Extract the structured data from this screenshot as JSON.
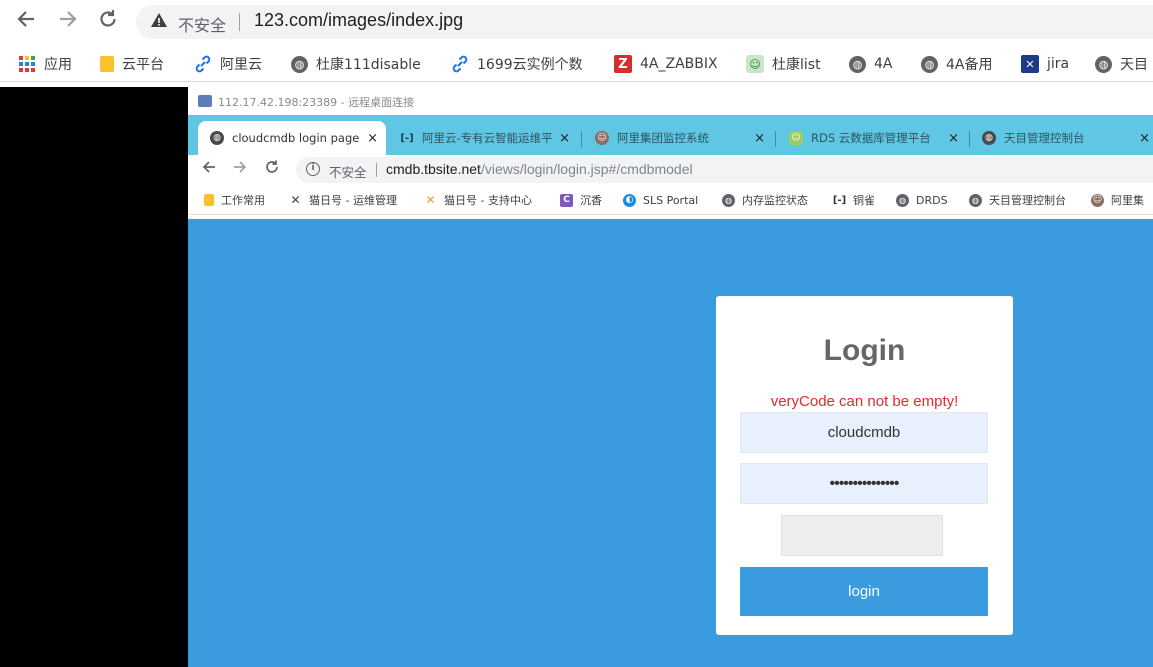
{
  "outer_browser": {
    "back_icon": "arrow-left",
    "forward_icon": "arrow-right",
    "reload_icon": "reload",
    "warning_icon": "warning-triangle",
    "insecure_label": "不安全",
    "url": "123.com/images/index.jpg",
    "bookmarks": [
      {
        "label": "应用",
        "icon": "apps-grid"
      },
      {
        "label": "云平台",
        "icon": "folder"
      },
      {
        "label": "阿里云",
        "icon": "link"
      },
      {
        "label": "杜康111disable",
        "icon": "globe"
      },
      {
        "label": "1699云实例个数",
        "icon": "link"
      },
      {
        "label": "4A_ZABBIX",
        "icon": "zabbix-z"
      },
      {
        "label": "杜康list",
        "icon": "face"
      },
      {
        "label": "4A",
        "icon": "globe"
      },
      {
        "label": "4A备用",
        "icon": "globe"
      },
      {
        "label": "jira",
        "icon": "jira"
      },
      {
        "label": "天目",
        "icon": "globe"
      }
    ]
  },
  "remote_desktop": {
    "title": "112.17.42.198:23389 - 远程桌面连接"
  },
  "inner_browser": {
    "tabs": [
      {
        "label": "cloudcmdb login page",
        "icon": "globe",
        "active": true
      },
      {
        "label": "阿里云-专有云智能运维平",
        "icon": "aliyun",
        "active": false
      },
      {
        "label": "阿里集团监控系统",
        "icon": "face",
        "active": false
      },
      {
        "label": "RDS 云数据库管理平台",
        "icon": "face-green",
        "active": false
      },
      {
        "label": "天目管理控制台",
        "icon": "globe",
        "active": false
      }
    ],
    "close_glyph": "×",
    "insecure_label": "不安全",
    "url_host": "cmdb.tbsite.net",
    "url_path": "/views/login/login.jsp#/cmdbmodel",
    "bookmarks": [
      {
        "label": "工作常用",
        "icon": "folder"
      },
      {
        "label": "猫日号 - 运维管理",
        "icon": "tool"
      },
      {
        "label": "猫日号 - 支持中心",
        "icon": "tool"
      },
      {
        "label": "沉香",
        "icon": "c-purple"
      },
      {
        "label": "SLS Portal",
        "icon": "sls"
      },
      {
        "label": "内存监控状态",
        "icon": "globe"
      },
      {
        "label": "铜雀",
        "icon": "aliyun"
      },
      {
        "label": "DRDS",
        "icon": "globe"
      },
      {
        "label": "天目管理控制台",
        "icon": "globe"
      },
      {
        "label": "阿里集",
        "icon": "face"
      }
    ]
  },
  "login": {
    "title": "Login",
    "error": "veryCode can not be empty!",
    "username_value": "cloudcmdb",
    "password_value": "•••••••••••••••",
    "button_label": "login"
  },
  "colors": {
    "page_background": "#3b9bdf",
    "login_button": "#3b9bdf",
    "error_text": "#e5292c",
    "tab_strip": "#5fc6e3"
  }
}
